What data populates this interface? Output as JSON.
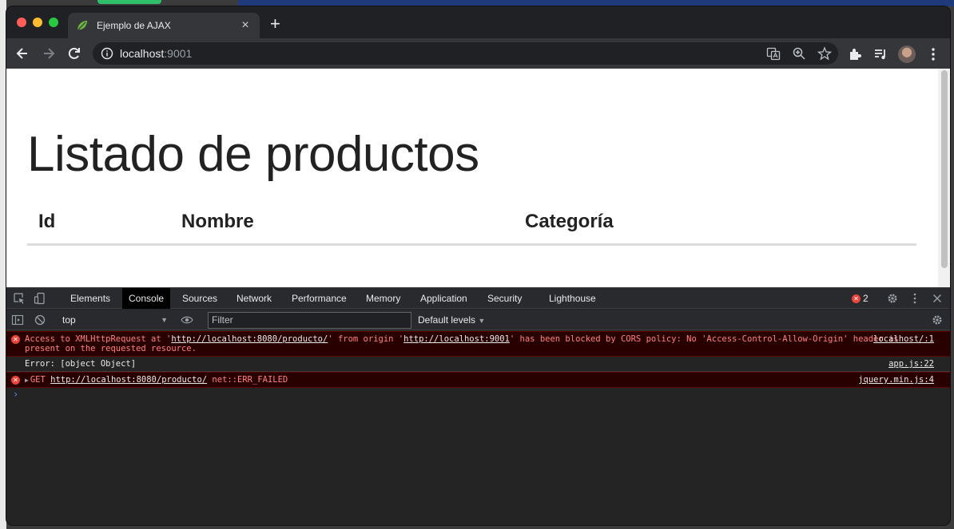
{
  "tab": {
    "title": "Ejemplo de AJAX",
    "close": "×",
    "new_tab": "+"
  },
  "omnibox": {
    "host": "localhost",
    "port": ":9001"
  },
  "page": {
    "title": "Listado de productos",
    "columns": [
      "Id",
      "Nombre",
      "Categoría"
    ]
  },
  "devtools": {
    "tabs": [
      "Elements",
      "Console",
      "Sources",
      "Network",
      "Performance",
      "Memory",
      "Application",
      "Security",
      "Lighthouse"
    ],
    "active_tab": "Console",
    "error_count": "2",
    "context": "top",
    "filter_placeholder": "Filter",
    "levels": "Default levels",
    "messages": [
      {
        "type": "error",
        "parts": [
          "Access to XMLHttpRequest at '",
          "http://localhost:8080/producto/",
          "' from origin '",
          "http://localhost:9001",
          "' has been blocked by CORS policy: No 'Access-Control-Allow-Origin' header is present on the requested resource."
        ],
        "source": "localhost/:1"
      },
      {
        "type": "info",
        "text": "Error: [object Object]",
        "source": "app.js:22"
      },
      {
        "type": "error",
        "method": "GET",
        "url": "http://localhost:8080/producto/",
        "status": "net::ERR_FAILED",
        "source": "jquery.min.js:4"
      }
    ],
    "prompt": "›"
  },
  "colors": {
    "accent_error": "#e8443a",
    "prompt": "#4c8ef7"
  }
}
